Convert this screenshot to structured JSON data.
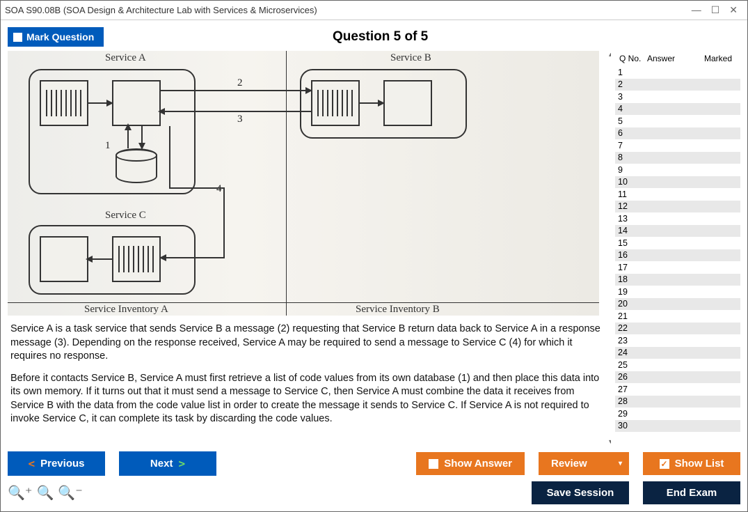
{
  "window": {
    "title": "SOA S90.08B (SOA Design & Architecture Lab with Services & Microservices)"
  },
  "header": {
    "mark_label": "Mark Question",
    "question_title": "Question 5 of 5"
  },
  "diagram": {
    "service_a": "Service A",
    "service_b": "Service B",
    "service_c": "Service C",
    "inventory_a": "Service Inventory A",
    "inventory_b": "Service Inventory B",
    "n1": "1",
    "n2": "2",
    "n3": "3",
    "n4": "4"
  },
  "question": {
    "p1": "Service A is a task service that sends Service B a message (2) requesting that Service B return data back to Service A in a response message (3). Depending on the response received, Service A may be required to send a message to Service C (4) for which it requires no response.",
    "p2": "Before it contacts Service B, Service A must first retrieve a list of code values from its own database (1) and then place this data into its own memory. If it turns out that it must send a message to Service C, then Service A must combine the data it receives from Service B with the data from the code value list in order to create the message it sends to Service C. If Service A is not required to invoke Service C, it can complete its task by discarding the code values."
  },
  "qlist": {
    "h1": "Q No.",
    "h2": "Answer",
    "h3": "Marked",
    "rows": [
      1,
      2,
      3,
      4,
      5,
      6,
      7,
      8,
      9,
      10,
      11,
      12,
      13,
      14,
      15,
      16,
      17,
      18,
      19,
      20,
      21,
      22,
      23,
      24,
      25,
      26,
      27,
      28,
      29,
      30
    ]
  },
  "buttons": {
    "previous": "Previous",
    "next": "Next",
    "show_answer": "Show Answer",
    "review": "Review",
    "show_list": "Show List",
    "save_session": "Save Session",
    "end_exam": "End Exam"
  }
}
